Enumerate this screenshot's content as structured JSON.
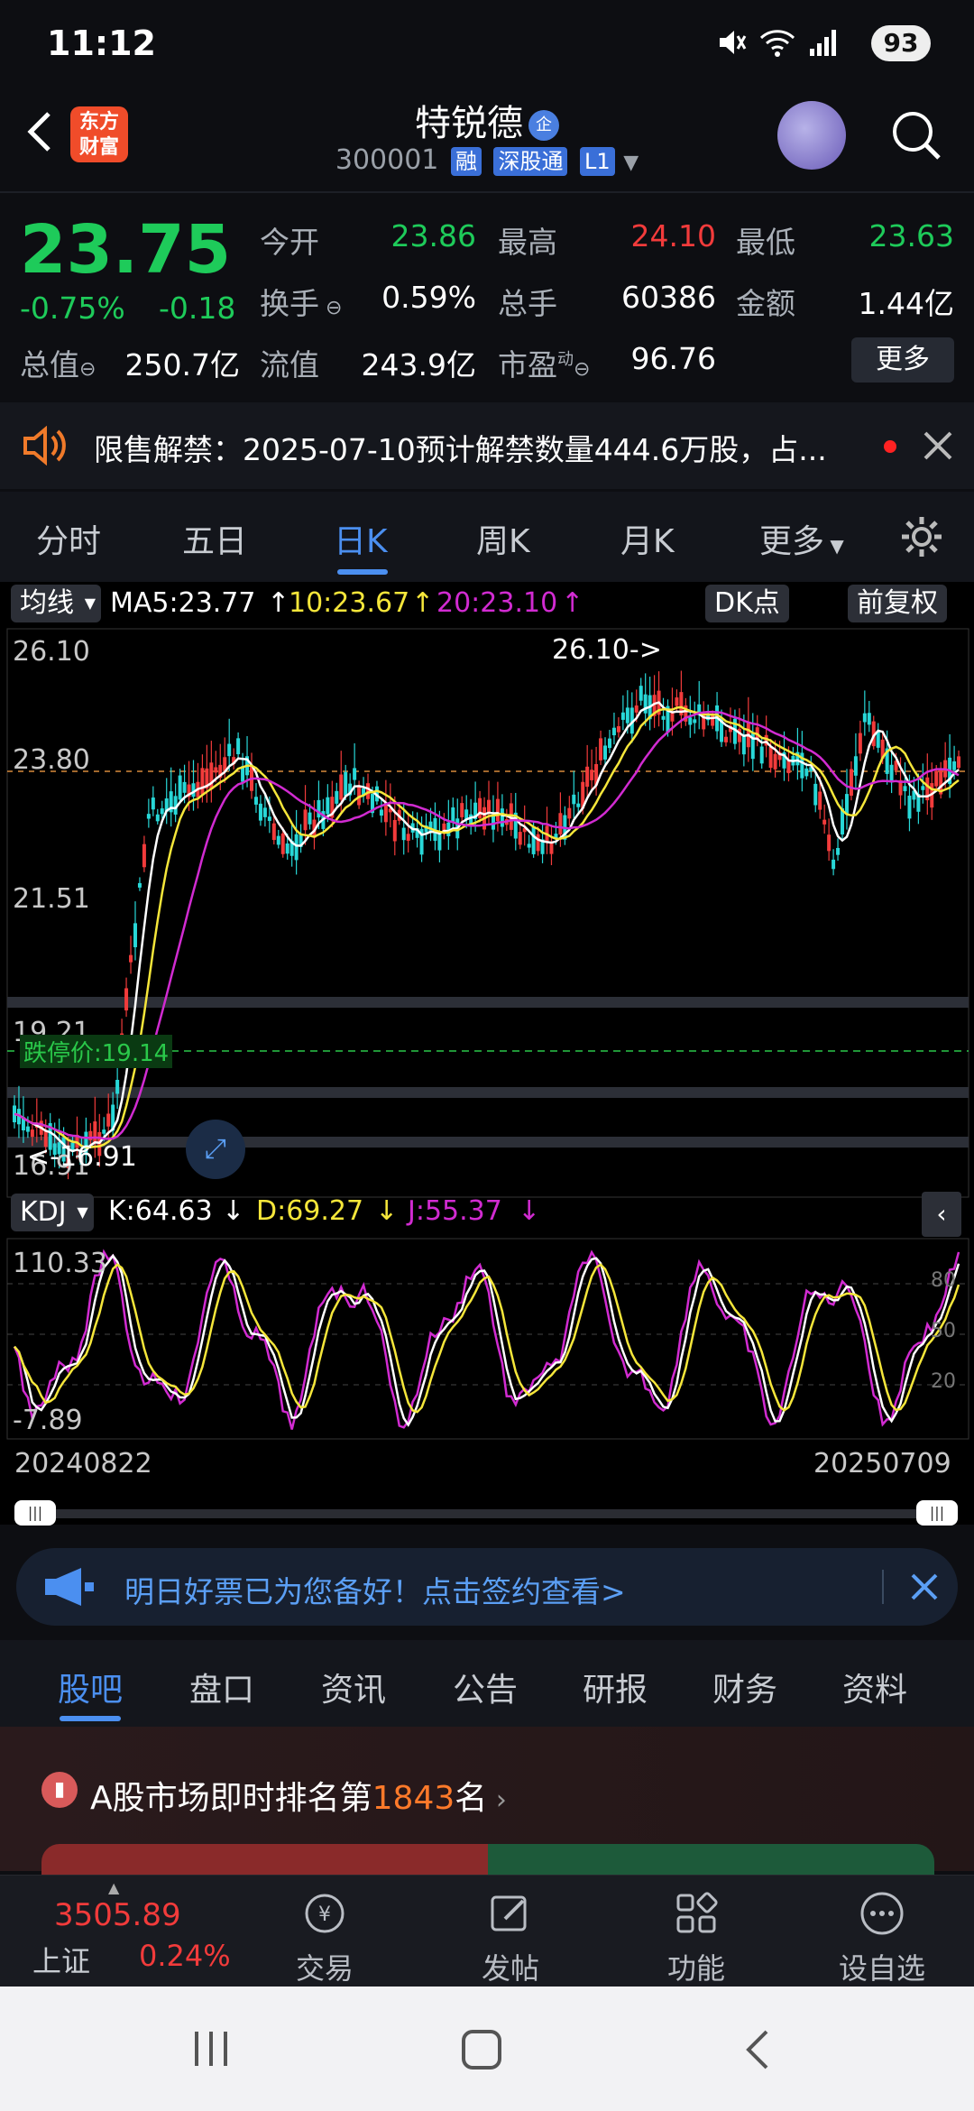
{
  "status": {
    "time": "11:12",
    "battery": "93"
  },
  "header": {
    "logo": "东方财富",
    "name": "特锐德",
    "badge": "企",
    "code": "300001",
    "tags": [
      "融",
      "深股通",
      "L1"
    ]
  },
  "quote": {
    "price": "23.75",
    "change_pct": "-0.75%",
    "change": "-0.18",
    "fields": [
      {
        "label": "今开",
        "value": "23.86",
        "tone": "green"
      },
      {
        "label": "最高",
        "value": "24.10",
        "tone": "red"
      },
      {
        "label": "最低",
        "value": "23.63",
        "tone": "green"
      },
      {
        "label": "换手",
        "value": "0.59%",
        "tone": "white"
      },
      {
        "label": "总手",
        "value": "60386",
        "tone": "white"
      },
      {
        "label": "金额",
        "value": "1.44亿",
        "tone": "white"
      },
      {
        "label": "总值",
        "value": "250.7亿",
        "tone": "white"
      },
      {
        "label": "流值",
        "value": "243.9亿",
        "tone": "white"
      },
      {
        "label": "市盈",
        "value": "96.76",
        "tone": "white"
      }
    ],
    "pe_sup": "动",
    "more_label": "更多"
  },
  "notice": {
    "text": "限售解禁：2025-07-10预计解禁数量444.6万股，占..."
  },
  "periods": [
    "分时",
    "五日",
    "日K",
    "周K",
    "月K",
    "更多"
  ],
  "chart": {
    "ma_selector": "均线",
    "ma5": "MA5:23.77",
    "ma10": "10:23.67",
    "ma20": "20:23.10",
    "dk_label": "DK点",
    "adjust_label": "前复权",
    "price_axis": [
      "26.10",
      "23.80",
      "21.51",
      "19.21",
      "16.91"
    ],
    "high_annotation": "26.10->",
    "low_annotation": "<-16.91",
    "limit_down": "跌停价:19.14",
    "kdj_selector": "KDJ",
    "k": "K:64.63",
    "d": "D:69.27",
    "j": "J:55.37",
    "kdj_axis": [
      "110.33",
      "-7.89"
    ],
    "kdj_levels": [
      "80",
      "50",
      "20"
    ],
    "start_date": "20240822",
    "end_date": "20250709",
    "colors": {
      "up": "#f23b3b",
      "down": "#28d8d8",
      "ma5": "#ffffff",
      "ma10": "#f5e63a",
      "ma20": "#d12bd1"
    }
  },
  "banner": {
    "text": "明日好票已为您备好！点击签约查看>"
  },
  "tabs": [
    "股吧",
    "盘口",
    "资讯",
    "公告",
    "研报",
    "财务",
    "资料"
  ],
  "rank": {
    "prefix": "A股市场即时排名第",
    "number": "1843",
    "suffix": "名"
  },
  "nav": {
    "index_value": "3505.89",
    "index_name": "上证",
    "index_pct": "0.24%",
    "items": [
      "交易",
      "发帖",
      "功能",
      "设自选"
    ]
  }
}
